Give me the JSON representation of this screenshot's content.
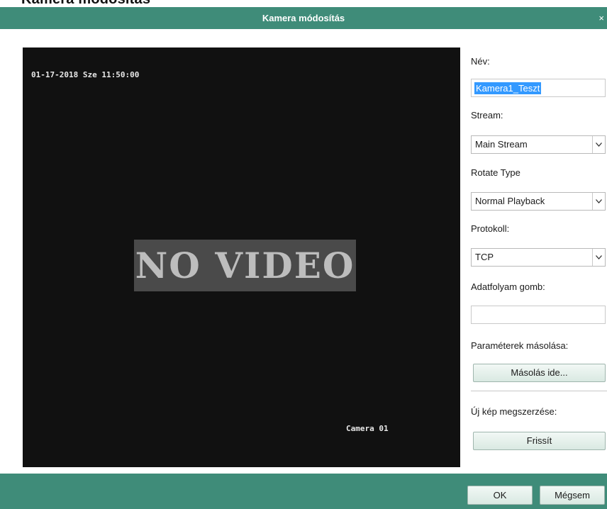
{
  "window": {
    "cropped_heading": "Kamera módosítás",
    "title": "Kamera módosítás",
    "close_label": "×"
  },
  "video": {
    "timestamp": "01-17-2018 Sze 11:50:00",
    "no_video_text": "NO VIDEO",
    "camera_label": "Camera 01"
  },
  "form": {
    "name_label": "Név:",
    "name_value": "Kamera1_Teszt",
    "stream_label": "Stream:",
    "stream_value": "Main Stream",
    "rotate_label": "Rotate Type",
    "rotate_value": "Normal Playback",
    "protocol_label": "Protokoll:",
    "protocol_value": "TCP",
    "stream_key_label": "Adatfolyam gomb:",
    "stream_key_value": "",
    "copy_params_label": "Paraméterek másolása:",
    "copy_button": "Másolás ide...",
    "new_image_label": "Új kép megszerzése:",
    "refresh_button": "Frissít"
  },
  "footer": {
    "ok_button": "OK",
    "cancel_button": "Mégsem"
  },
  "colors": {
    "titlebar": "#3f8c79",
    "video_bg": "#111111",
    "selection": "#3399ff"
  }
}
